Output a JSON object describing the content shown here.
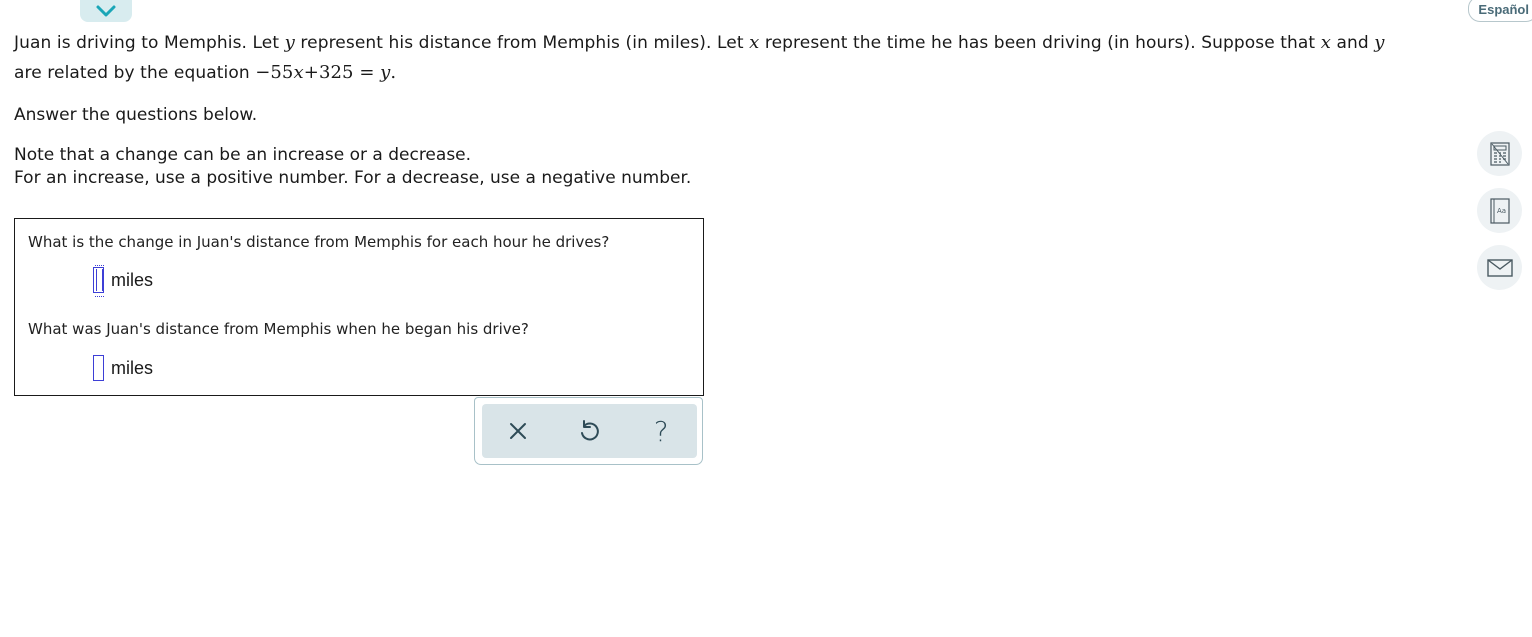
{
  "header": {
    "language_label": "Español"
  },
  "problem": {
    "line1_a": "Juan is driving to Memphis. Let ",
    "var_y": "y",
    "line1_b": " represent his distance from Memphis (in miles). Let ",
    "var_x": "x",
    "line1_c": " represent the time he has been driving (in hours). Suppose that ",
    "line1_d": " and ",
    "line2_a": "are related by the equation ",
    "eq_a": "−55",
    "eq_x": "x",
    "eq_b": "+325 =",
    "eq_y": "y",
    "eq_end": "."
  },
  "instructions": {
    "answer_below": "Answer the questions below.",
    "note1": "Note that a change can be an increase or a decrease.",
    "note2": "For an increase, use a positive number. For a decrease, use a negative number."
  },
  "questions": [
    {
      "text": "What is the change in Juan's distance from Memphis for each hour he drives?",
      "value": "",
      "unit": "miles"
    },
    {
      "text": "What was Juan's distance from Memphis when he began his drive?",
      "value": "",
      "unit": "miles"
    }
  ],
  "toolbar": {
    "icons": [
      "close-icon",
      "undo-icon",
      "help-icon"
    ],
    "help_glyph": "?"
  },
  "side_tools": [
    "calculator-icon",
    "dictionary-icon",
    "mail-icon"
  ]
}
